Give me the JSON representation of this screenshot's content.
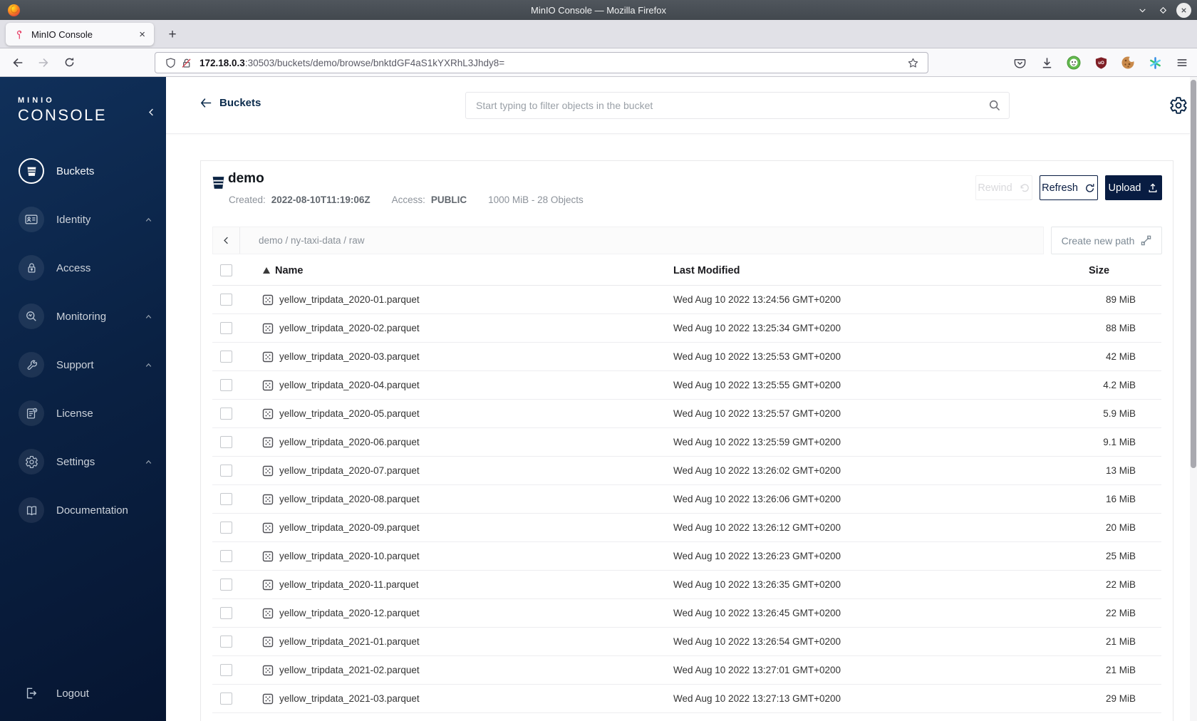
{
  "window": {
    "title": "MinIO Console — Mozilla Firefox"
  },
  "browser": {
    "tab_title": "MinIO Console",
    "tab_close_glyph": "×",
    "new_tab_glyph": "+",
    "url_host": "172.18.0.3",
    "url_rest": ":30503/buckets/demo/browse/bnktdGF4aS1kYXRhL3Jhdy8="
  },
  "sidebar": {
    "logo_top": "MINIO",
    "logo_main": "CONSOLE",
    "items": [
      {
        "label": "Buckets"
      },
      {
        "label": "Identity"
      },
      {
        "label": "Access"
      },
      {
        "label": "Monitoring"
      },
      {
        "label": "Support"
      },
      {
        "label": "License"
      },
      {
        "label": "Settings"
      },
      {
        "label": "Documentation"
      }
    ],
    "logout_label": "Logout"
  },
  "header": {
    "back_label": "Buckets",
    "search_placeholder": "Start typing to filter objects in the bucket"
  },
  "bucket": {
    "name": "demo",
    "created_label": "Created:",
    "created_value": "2022-08-10T11:19:06Z",
    "access_label": "Access:",
    "access_value": "PUBLIC",
    "summary": "1000 MiB - 28 Objects",
    "rewind_label": "Rewind",
    "refresh_label": "Refresh",
    "upload_label": "Upload"
  },
  "browse": {
    "breadcrumb": "demo / ny-taxi-data / raw",
    "create_path_label": "Create new path"
  },
  "table": {
    "columns": {
      "name": "Name",
      "modified": "Last Modified",
      "size": "Size"
    },
    "rows": [
      {
        "name": "yellow_tripdata_2020-01.parquet",
        "modified": "Wed Aug 10 2022 13:24:56 GMT+0200",
        "size": "89 MiB"
      },
      {
        "name": "yellow_tripdata_2020-02.parquet",
        "modified": "Wed Aug 10 2022 13:25:34 GMT+0200",
        "size": "88 MiB"
      },
      {
        "name": "yellow_tripdata_2020-03.parquet",
        "modified": "Wed Aug 10 2022 13:25:53 GMT+0200",
        "size": "42 MiB"
      },
      {
        "name": "yellow_tripdata_2020-04.parquet",
        "modified": "Wed Aug 10 2022 13:25:55 GMT+0200",
        "size": "4.2 MiB"
      },
      {
        "name": "yellow_tripdata_2020-05.parquet",
        "modified": "Wed Aug 10 2022 13:25:57 GMT+0200",
        "size": "5.9 MiB"
      },
      {
        "name": "yellow_tripdata_2020-06.parquet",
        "modified": "Wed Aug 10 2022 13:25:59 GMT+0200",
        "size": "9.1 MiB"
      },
      {
        "name": "yellow_tripdata_2020-07.parquet",
        "modified": "Wed Aug 10 2022 13:26:02 GMT+0200",
        "size": "13 MiB"
      },
      {
        "name": "yellow_tripdata_2020-08.parquet",
        "modified": "Wed Aug 10 2022 13:26:06 GMT+0200",
        "size": "16 MiB"
      },
      {
        "name": "yellow_tripdata_2020-09.parquet",
        "modified": "Wed Aug 10 2022 13:26:12 GMT+0200",
        "size": "20 MiB"
      },
      {
        "name": "yellow_tripdata_2020-10.parquet",
        "modified": "Wed Aug 10 2022 13:26:23 GMT+0200",
        "size": "25 MiB"
      },
      {
        "name": "yellow_tripdata_2020-11.parquet",
        "modified": "Wed Aug 10 2022 13:26:35 GMT+0200",
        "size": "22 MiB"
      },
      {
        "name": "yellow_tripdata_2020-12.parquet",
        "modified": "Wed Aug 10 2022 13:26:45 GMT+0200",
        "size": "22 MiB"
      },
      {
        "name": "yellow_tripdata_2021-01.parquet",
        "modified": "Wed Aug 10 2022 13:26:54 GMT+0200",
        "size": "21 MiB"
      },
      {
        "name": "yellow_tripdata_2021-02.parquet",
        "modified": "Wed Aug 10 2022 13:27:01 GMT+0200",
        "size": "21 MiB"
      },
      {
        "name": "yellow_tripdata_2021-03.parquet",
        "modified": "Wed Aug 10 2022 13:27:13 GMT+0200",
        "size": "29 MiB"
      }
    ]
  },
  "colors": {
    "accent_navy": "#081C42",
    "sidebar_top": "#10305A",
    "tab_pink": "#E84A6F",
    "disabled_text": "#D9D9DC"
  }
}
